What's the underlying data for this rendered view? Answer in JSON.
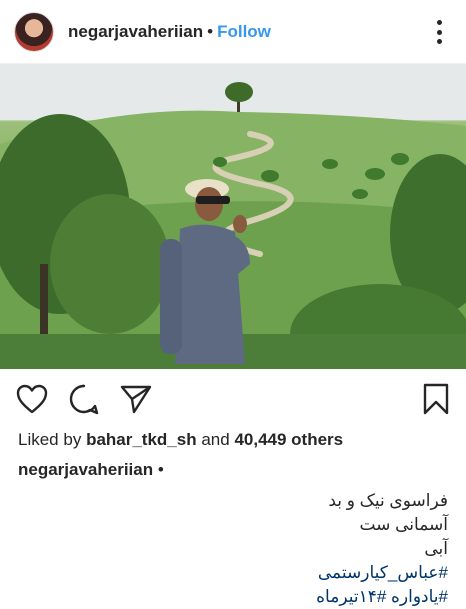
{
  "header": {
    "avatar_icon": "profile-avatar",
    "username": "negarjavaheriian",
    "separator": "•",
    "follow_label": "Follow",
    "more_icon": "more-options-vertical-icon"
  },
  "post": {
    "image_icon": "post-photo"
  },
  "actions": {
    "like_icon": "heart-icon",
    "comment_icon": "comment-icon",
    "share_icon": "send-icon",
    "save_icon": "bookmark-icon"
  },
  "likes": {
    "prefix": "Liked by",
    "user": "bahar_tkd_sh",
    "middle": "and",
    "count": "40,449 others"
  },
  "caption": {
    "username": "negarjavaheriian",
    "suffix": "•",
    "lines": [
      "فراسوی نیک و بد",
      "آسمانی ست",
      "آبی"
    ],
    "hashtags": [
      "#عباس_کیارستمی",
      "#یادواره #۱۴تیرماه"
    ]
  },
  "colors": {
    "link": "#3897f0",
    "hashtag": "#003569",
    "text": "#262626"
  }
}
